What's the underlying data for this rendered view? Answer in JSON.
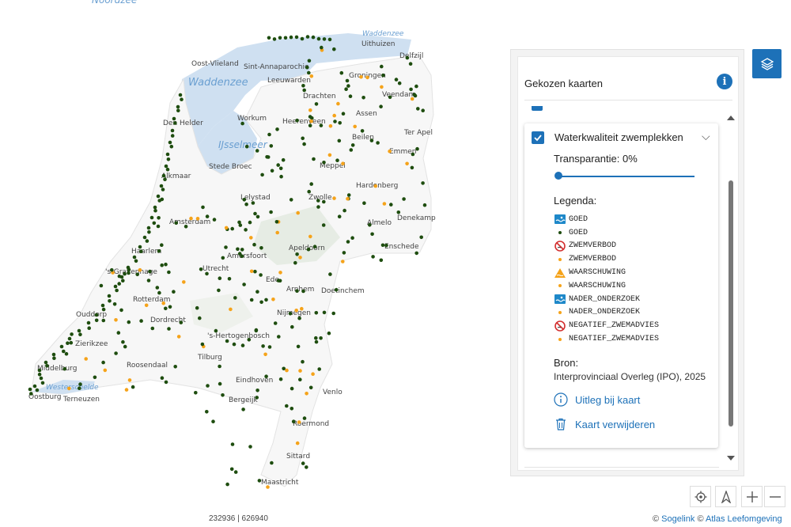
{
  "map": {
    "water_labels": [
      {
        "text": "Noordzee"
      },
      {
        "text": "Waddenzee"
      },
      {
        "text": "Waddenzee"
      },
      {
        "text": "IJsselmeer"
      },
      {
        "text": "Westerschelde"
      }
    ],
    "places": [
      "Uithuizen",
      "Delfzijl",
      "Oost-Vlieland",
      "Sint-Annaparochie",
      "Leeuwarden",
      "Groningen",
      "Drachten",
      "Veendam",
      "Den Helder",
      "Workum",
      "Heerenveen",
      "Assen",
      "Ter Apel",
      "Beilen",
      "Emmen",
      "Stede Broec",
      "Meppel",
      "Alkmaar",
      "Lelystad",
      "Hardenberg",
      "Zwolle",
      "Denekamp",
      "Amsterdam",
      "Almelo",
      "Enschede",
      "Haarlem",
      "Amersfoort",
      "Apeldoorn",
      "'s-Gravenhage",
      "Utrecht",
      "Ede",
      "Rotterdam",
      "Arnhem",
      "Doetinchem",
      "Ouddorp",
      "Dordrecht",
      "Nijmegen",
      "Zierikzee",
      "'s-Hertogenbosch",
      "Roosendaal",
      "Tilburg",
      "Middelburg",
      "Eindhoven",
      "Venlo",
      "Oostburg",
      "Terneuzen",
      "Bergeijk",
      "Roermond",
      "Sittard",
      "Maastricht"
    ]
  },
  "panel": {
    "title": "Gekozen kaarten",
    "layer": {
      "title": "Waterkwaliteit zwemplekken",
      "checked": true,
      "transparency_label": "Transparantie:",
      "transparency_value": "0%",
      "transparency_fraction": 0,
      "legend_title": "Legenda:",
      "legend": [
        {
          "label": "GOED",
          "icon": "swim-icon"
        },
        {
          "label": "GOED",
          "icon": "dot-dark"
        },
        {
          "label": "ZWEMVERBOD",
          "icon": "no-swim-icon"
        },
        {
          "label": "ZWEMVERBOD",
          "icon": "dot-orange"
        },
        {
          "label": "WAARSCHUWING",
          "icon": "warning-icon"
        },
        {
          "label": "WAARSCHUWING",
          "icon": "dot-orange"
        },
        {
          "label": "NADER_ONDERZOEK",
          "icon": "swim-icon"
        },
        {
          "label": "NADER_ONDERZOEK",
          "icon": "dot-orange"
        },
        {
          "label": "NEGATIEF_ZWEMADVIES",
          "icon": "no-swim-icon"
        },
        {
          "label": "NEGATIEF_ZWEMADVIES",
          "icon": "dot-orange"
        }
      ],
      "source_label": "Bron:",
      "source_value": "Interprovinciaal Overleg (IPO), 2025",
      "explain_link": "Uitleg bij kaart",
      "remove_link": "Kaart verwijderen"
    }
  },
  "coordinates": "232936 | 626940",
  "attribution": {
    "copy1": "©",
    "sogelink": "Sogelink",
    "copy2": "©",
    "atlas": "Atlas Leefomgeving"
  },
  "colors": {
    "accent": "#1d71b8",
    "dot_good": "#1e4d0f",
    "dot_warn": "#f5a31a",
    "land": "#f7f7f7",
    "sea": "#cfe0f1"
  }
}
